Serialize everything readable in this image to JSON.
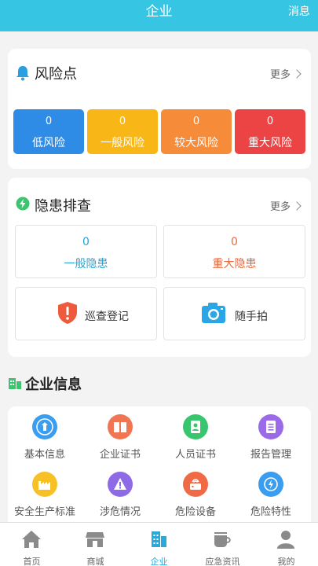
{
  "topbar": {
    "title": "企业",
    "message": "消息"
  },
  "risk": {
    "title": "风险点",
    "more": "更多",
    "items": [
      {
        "value": "0",
        "label": "低风险",
        "color": "#2f8ce6"
      },
      {
        "value": "0",
        "label": "一般风险",
        "color": "#f8b617"
      },
      {
        "value": "0",
        "label": "较大风险",
        "color": "#f68c3a"
      },
      {
        "value": "0",
        "label": "重大风险",
        "color": "#ec4445"
      }
    ]
  },
  "hazard": {
    "title": "隐患排查",
    "more": "更多",
    "general": {
      "value": "0",
      "label": "一般隐患",
      "color": "#28a3d4"
    },
    "major": {
      "value": "0",
      "label": "重大隐患",
      "color": "#e8673c"
    },
    "inspect_label": "巡查登记",
    "photo_label": "随手拍"
  },
  "company": {
    "title": "企业信息",
    "items": [
      {
        "label": "基本信息",
        "icon": "company-icon",
        "color": "#3a9df0"
      },
      {
        "label": "企业证书",
        "icon": "book-icon",
        "color": "#f07553"
      },
      {
        "label": "人员证书",
        "icon": "person-certificate-icon",
        "color": "#37c66e"
      },
      {
        "label": "报告管理",
        "icon": "report-icon",
        "color": "#9b6ae8"
      },
      {
        "label": "安全生产标准",
        "icon": "factory-icon",
        "color": "#f7c125"
      },
      {
        "label": "涉危情况",
        "icon": "warning-icon",
        "color": "#8e6ae6"
      },
      {
        "label": "危险设备",
        "icon": "device-icon",
        "color": "#ef6a45"
      },
      {
        "label": "危险特性",
        "icon": "hazard-icon",
        "color": "#3a9df0"
      }
    ]
  },
  "tabs": [
    {
      "label": "首页",
      "icon": "home-icon"
    },
    {
      "label": "商城",
      "icon": "store-icon"
    },
    {
      "label": "企业",
      "icon": "enterprise-icon"
    },
    {
      "label": "应急资讯",
      "icon": "news-icon"
    },
    {
      "label": "我的",
      "icon": "user-icon"
    }
  ],
  "active_tab": "企业"
}
